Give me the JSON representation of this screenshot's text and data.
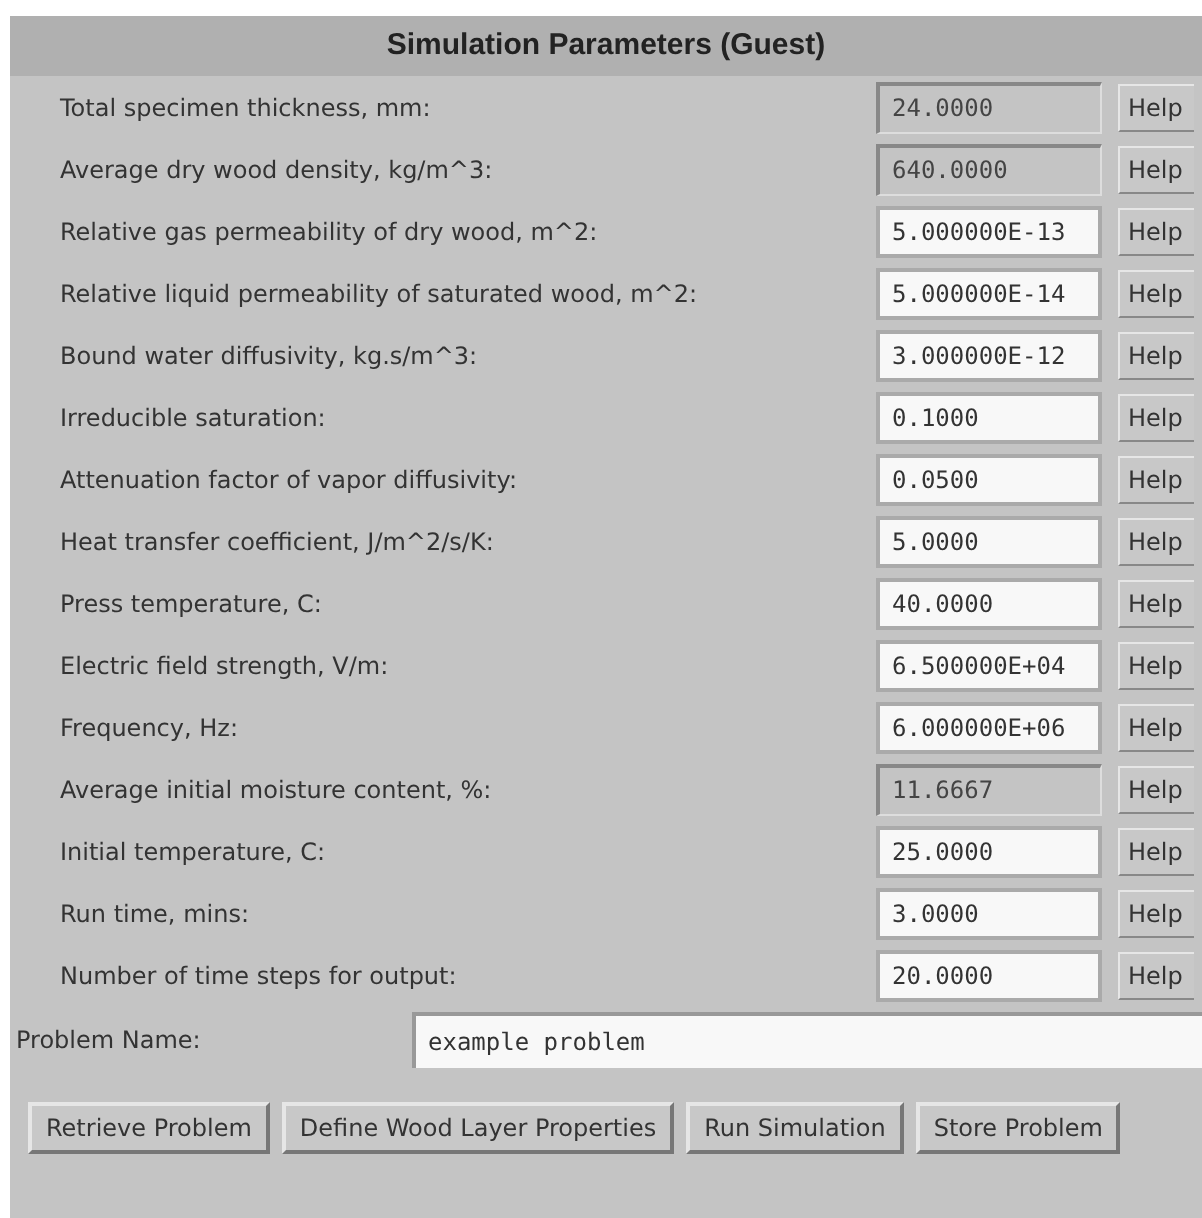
{
  "title": "Simulation Parameters (Guest)",
  "parameters": [
    {
      "label": "Total specimen thickness, mm:",
      "value": "24.0000",
      "disabled": true,
      "help": "Help"
    },
    {
      "label": "Average dry wood density, kg/m^3:",
      "value": "640.0000",
      "disabled": true,
      "help": "Help"
    },
    {
      "label": "Relative gas permeability of dry wood, m^2:",
      "value": "5.000000E-13",
      "disabled": false,
      "help": "Help"
    },
    {
      "label": "Relative liquid permeability of saturated wood, m^2:",
      "value": "5.000000E-14",
      "disabled": false,
      "help": "Help"
    },
    {
      "label": "Bound water diffusivity, kg.s/m^3:",
      "value": "3.000000E-12",
      "disabled": false,
      "help": "Help"
    },
    {
      "label": "Irreducible saturation:",
      "value": "0.1000",
      "disabled": false,
      "help": "Help"
    },
    {
      "label": "Attenuation factor of vapor diffusivity:",
      "value": "0.0500",
      "disabled": false,
      "help": "Help"
    },
    {
      "label": "Heat transfer coefficient, J/m^2/s/K:",
      "value": "5.0000",
      "disabled": false,
      "help": "Help"
    },
    {
      "label": "Press temperature, C:",
      "value": "40.0000",
      "disabled": false,
      "help": "Help"
    },
    {
      "label": "Electric field strength, V/m:",
      "value": "6.500000E+04",
      "disabled": false,
      "help": "Help"
    },
    {
      "label": "Frequency, Hz:",
      "value": "6.000000E+06",
      "disabled": false,
      "help": "Help"
    },
    {
      "label": "Average initial moisture content, %:",
      "value": "11.6667",
      "disabled": true,
      "help": "Help"
    },
    {
      "label": "Initial temperature, C:",
      "value": "25.0000",
      "disabled": false,
      "help": "Help"
    },
    {
      "label": "Run time, mins:",
      "value": "3.0000",
      "disabled": false,
      "help": "Help"
    },
    {
      "label": "Number of time steps for output:",
      "value": "20.0000",
      "disabled": false,
      "help": "Help"
    }
  ],
  "problem_name": {
    "label": "Problem Name:",
    "value": "example problem"
  },
  "buttons": [
    "Retrieve Problem",
    "Define Wood Layer Properties",
    "Run Simulation",
    "Store Problem"
  ]
}
